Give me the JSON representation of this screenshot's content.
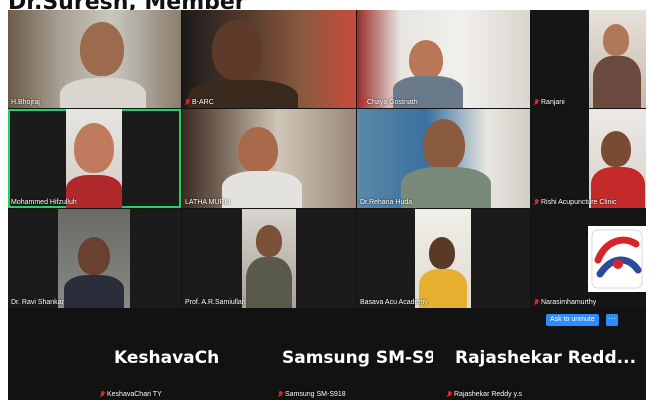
{
  "caption": "Dr.Suresh, Member",
  "participants": [
    {
      "name": "H.Bhojraj",
      "muted": false
    },
    {
      "name": "B-ARC",
      "muted": true
    },
    {
      "name": "Chaya Gostnath",
      "muted": true
    },
    {
      "name": "Ranjani",
      "muted": true
    },
    {
      "name": "Mohammed Hifzulluh",
      "muted": false
    },
    {
      "name": "LATHA MURLI",
      "muted": false
    },
    {
      "name": "Dr.Rehana Huda",
      "muted": false
    },
    {
      "name": "Rishi Acupuncture Clinic",
      "muted": true
    },
    {
      "name": "Dr. Ravi Shankar",
      "muted": false
    },
    {
      "name": "Prof. A.R.Samiullah",
      "muted": false
    },
    {
      "name": "Basava Acu Academy",
      "muted": false
    },
    {
      "name": "Narasimhamurthy",
      "muted": true
    }
  ],
  "bottom_row": [
    {
      "display": "KeshavaChari TY",
      "name": "KeshavaChari TY"
    },
    {
      "display": "Samsung  SM-S9...",
      "name": "Samsung SM-S918"
    },
    {
      "display": "Rajashekar  Redd...",
      "name": "Rajashekar Reddy y.s"
    }
  ],
  "unmute_label": "Ask to unmute",
  "more_label": "···",
  "colors": {
    "active_border": "#23d160",
    "muted_icon": "#e02424",
    "button": "#2d8cff"
  }
}
